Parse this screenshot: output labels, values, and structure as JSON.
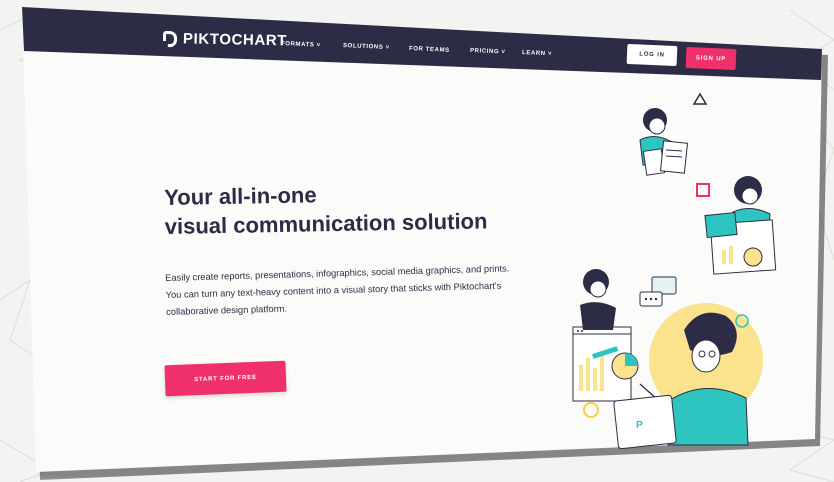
{
  "brand": {
    "name": "PIKTOCHART"
  },
  "nav": {
    "items": [
      {
        "label": "FORMATS"
      },
      {
        "label": "SOLUTIONS"
      },
      {
        "label": "FOR TEAMS"
      },
      {
        "label": "PRICING"
      },
      {
        "label": "LEARN"
      }
    ],
    "login_label": "LOG IN",
    "signup_label": "SIGN UP"
  },
  "hero": {
    "title_line1": "Your all-in-one",
    "title_line2": "visual communication solution",
    "description": "Easily create reports, presentations, infographics, social media graphics, and prints. You can turn any text-heavy content into a visual story that sticks with Piktochart's collaborative design platform.",
    "cta_label": "START FOR FREE"
  },
  "colors": {
    "navy": "#2d2c46",
    "pink": "#f0306b",
    "teal": "#2ec4c0",
    "yellow": "#fbe28c"
  }
}
